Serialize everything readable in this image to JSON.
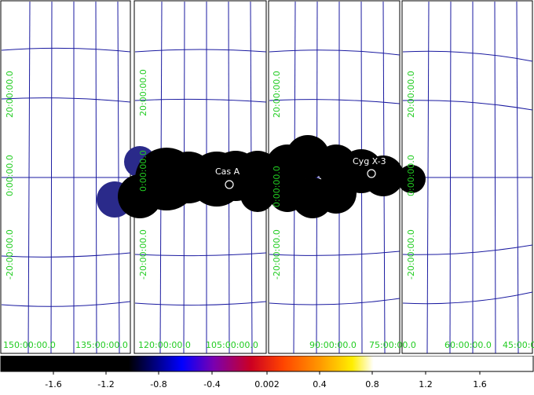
{
  "sources": [
    {
      "name": "Cas A"
    },
    {
      "name": "Cyg X-3"
    }
  ],
  "grid_labels": {
    "dec_labels": [
      "20:00:00.0",
      "0:00:00.0",
      "-20:00:00.0"
    ],
    "ra_labels": [
      "150:00:00.0",
      "135:00:00.0",
      "120:00:00.0",
      "105:00:00.0",
      "90:00:00.0",
      "75:00:00.0",
      "60:00:00.0",
      "45:00:00.0"
    ]
  },
  "colorbar": {
    "ticks": [
      "-1.6",
      "-1.2",
      "-0.8",
      "-0.4",
      "0.002",
      "0.4",
      "0.8",
      "1.2",
      "1.6"
    ]
  },
  "colors": {
    "grid": "#1a1aa0",
    "coord_text": "#22cc22",
    "panel_border": "#000000"
  }
}
